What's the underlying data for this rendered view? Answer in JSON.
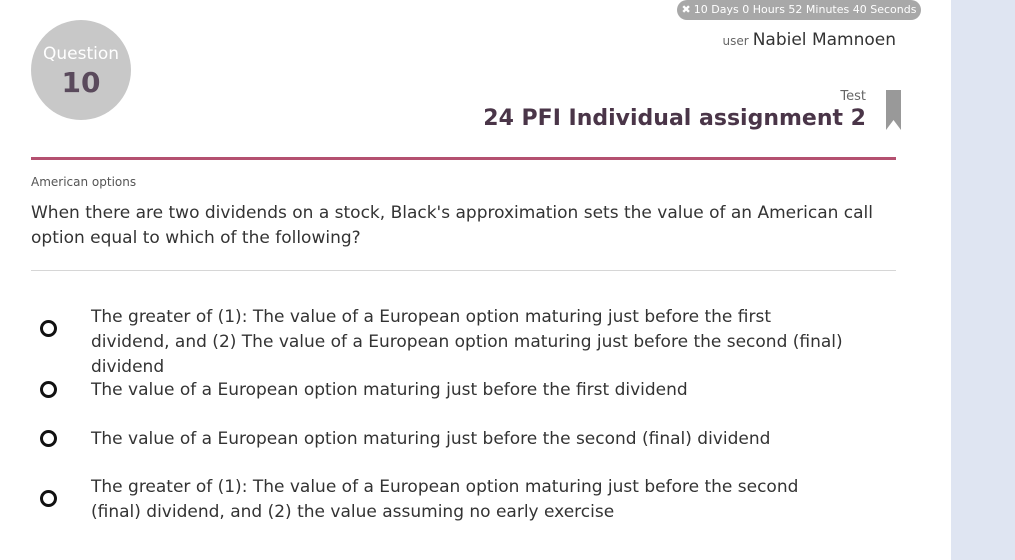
{
  "timer": {
    "icon": "close-icon",
    "text": "10 Days 0 Hours 52 Minutes 40 Seconds"
  },
  "user": {
    "label": "user",
    "name": "Nabiel Mamnoen"
  },
  "question_badge": {
    "label": "Question",
    "number": "10"
  },
  "test": {
    "label": "Test",
    "title": "24 PFI Individual assignment 2"
  },
  "question": {
    "category": "American options",
    "text": "When there are two dividends on a stock, Black's approximation sets the value of an American call option equal to which of the following?",
    "options": [
      {
        "text": "The greater of (1): The value of a European option maturing just before the first dividend, and (2) The value of a European option maturing just before the second (final) dividend"
      },
      {
        "text": "The value of a European option maturing just before the first dividend"
      },
      {
        "text": "The value of a European option maturing just before the second (final) dividend"
      },
      {
        "text": "The greater of (1): The value of a European option maturing just before the second (final) dividend, and (2) the value assuming no early exercise"
      }
    ]
  },
  "colors": {
    "accent": "#b45070",
    "badge_bg": "#c8c8c8",
    "timer_bg": "#a8a8a8",
    "title": "#4a3548",
    "side_panel": "#dfe5f2"
  }
}
